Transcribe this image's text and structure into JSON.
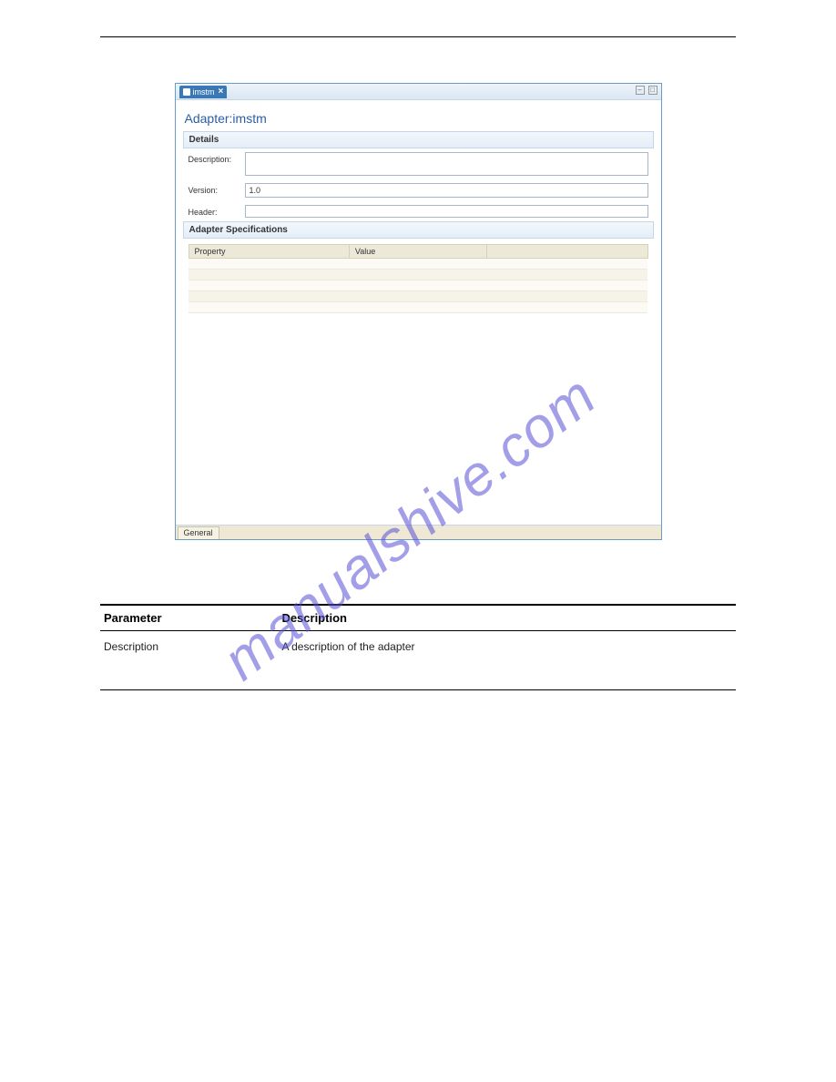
{
  "watermark": "manualshive.com",
  "window": {
    "tab_label": "imstm",
    "adapter_title": "Adapter:imstm",
    "sections": {
      "details": "Details",
      "adapter_specs": "Adapter Specifications"
    },
    "form": {
      "description_label": "Description:",
      "description_value": "",
      "version_label": "Version:",
      "version_value": "1.0",
      "header_label": "Header:",
      "header_value": ""
    },
    "spec_columns": {
      "property": "Property",
      "value": "Value",
      "third": ""
    },
    "bottom_tab": "General"
  },
  "params_table": {
    "col_parameter": "Parameter",
    "col_description": "Description",
    "row1_param": "Description",
    "row1_desc": "A description of the adapter"
  }
}
